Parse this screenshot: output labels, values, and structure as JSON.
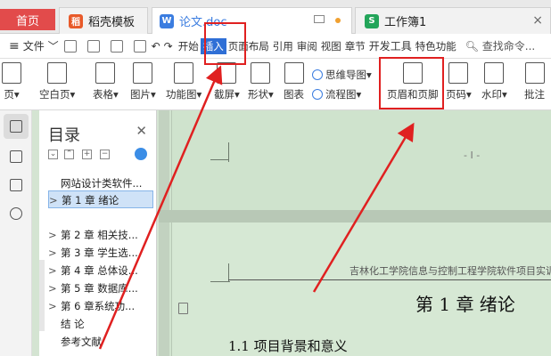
{
  "tabs": {
    "home": "首页",
    "template": "稻壳模板",
    "doc": "论文.doc",
    "sheet": "工作簿1"
  },
  "menubar": {
    "file": "文件",
    "tabs": [
      "开始",
      "插入",
      "页面布局",
      "引用",
      "审阅",
      "视图",
      "章节",
      "开发工具",
      "特色功能"
    ],
    "search": "查找命令..."
  },
  "ribbon": {
    "left": [
      {
        "label": "页▾"
      },
      {
        "label": "空白页▾"
      },
      {
        "label": "表格▾"
      },
      {
        "label": "图片▾"
      },
      {
        "label": "功能图▾"
      },
      {
        "label": "截屏▾"
      },
      {
        "label": "形状▾"
      },
      {
        "label": "图表"
      }
    ],
    "mindmap": "思维导图▾",
    "flowchart": "流程图▾",
    "right": [
      {
        "label": "页眉和页脚"
      },
      {
        "label": "页码▾"
      },
      {
        "label": "水印▾"
      },
      {
        "label": "批注"
      }
    ]
  },
  "toc": {
    "title": "目录",
    "items": [
      {
        "chev": "",
        "label": "网站设计类软件..."
      },
      {
        "chev": ">",
        "label": "第 1 章  绪论"
      },
      {
        "chev": ">",
        "label": "第 2 章  相关技..."
      },
      {
        "chev": ">",
        "label": "第 3 章  学生选..."
      },
      {
        "chev": ">",
        "label": "第 4 章  总体设..."
      },
      {
        "chev": ">",
        "label": "第 5 章  数据库..."
      },
      {
        "chev": ">",
        "label": "第 6 章系统功..."
      },
      {
        "chev": "",
        "label": "结      论"
      },
      {
        "chev": "",
        "label": "参考文献"
      }
    ]
  },
  "document": {
    "header_text": "吉林化工学院信息与控制工程学院软件项目实训",
    "chapter_title": "第 1 章  绪论",
    "section_title": "1.1  项目背景和意义",
    "cursor_mark": "- I -"
  },
  "colors": {
    "accent": "#2f6fd6",
    "annotation": "#e02020",
    "doc_background": "#d1e4cf"
  }
}
